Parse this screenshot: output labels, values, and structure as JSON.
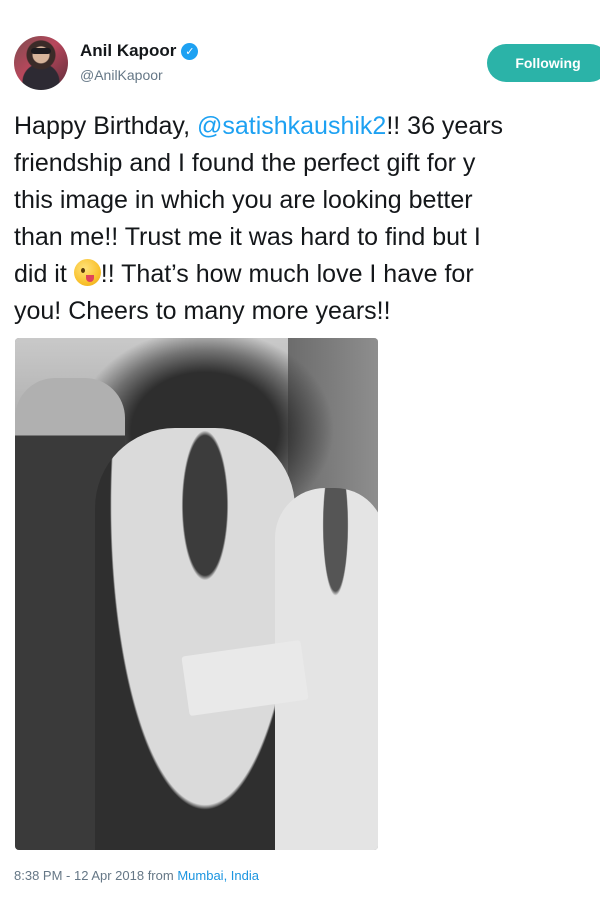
{
  "author": {
    "display_name": "Anil Kapoor",
    "handle": "@AnilKapoor",
    "verified_icon": "verified-badge-icon",
    "avatar_icon": "profile-photo"
  },
  "follow_button": {
    "label": "Following",
    "color": "#2bb3a8"
  },
  "tweet": {
    "lines": [
      {
        "before": "Happy Birthday, ",
        "mention": "@satishkaushik2",
        "after": "!! 36 years"
      },
      {
        "text": "friendship and I found the perfect gift for y"
      },
      {
        "text": "this image in which you are looking better"
      },
      {
        "text": "than me!! Trust me it was hard to find but I"
      },
      {
        "before": "did it ",
        "emoji": "winking-tongue-face-emoji",
        "after": "!! That’s how much love I have for"
      },
      {
        "text": "you! Cheers to many more years!!"
      }
    ]
  },
  "photo": {
    "description_icon": "black-and-white-photo"
  },
  "meta": {
    "timestamp": "8:38 PM - 12 Apr 2018 from",
    "location": "Mumbai, India"
  },
  "colors": {
    "link": "#1da1f2",
    "secondary_text": "#657786"
  }
}
